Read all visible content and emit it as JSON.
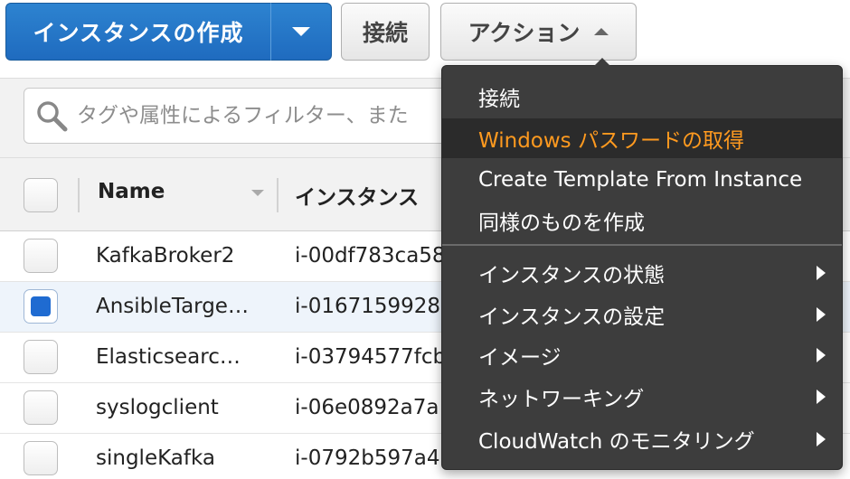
{
  "toolbar": {
    "launch_label": "インスタンスの作成",
    "connect_label": "接続",
    "actions_label": "アクション"
  },
  "filter": {
    "placeholder": "タグや属性によるフィルター、また"
  },
  "table": {
    "columns": [
      "Name",
      "インスタンス"
    ],
    "rows": [
      {
        "name": "KafkaBroker2",
        "id": "i-00df783ca58",
        "selected": false
      },
      {
        "name": "AnsibleTarge…",
        "id": "i-0167159928c",
        "selected": true
      },
      {
        "name": "Elasticsearc…",
        "id": "i-03794577fcb",
        "selected": false
      },
      {
        "name": "syslogclient",
        "id": "i-06e0892a7a",
        "selected": false
      },
      {
        "name": "singleKafka",
        "id": "i-0792b597a4",
        "selected": false
      }
    ]
  },
  "menu": {
    "items": [
      {
        "label": "接続",
        "submenu": false
      },
      {
        "label": "Windows パスワードの取得",
        "submenu": false,
        "highlighted": true
      },
      {
        "label": "Create Template From Instance",
        "submenu": false
      },
      {
        "label": "同様のものを作成",
        "submenu": false
      },
      {
        "label": "インスタンスの状態",
        "submenu": true
      },
      {
        "label": "インスタンスの設定",
        "submenu": true
      },
      {
        "label": "イメージ",
        "submenu": true
      },
      {
        "label": "ネットワーキング",
        "submenu": true
      },
      {
        "label": "CloudWatch のモニタリング",
        "submenu": true
      }
    ]
  },
  "colors": {
    "primary_button": "#1f6bbf",
    "menu_background": "#3d3d3d",
    "menu_highlight_text": "#ff9a1f",
    "checkbox_checked": "#1f6bd1"
  }
}
